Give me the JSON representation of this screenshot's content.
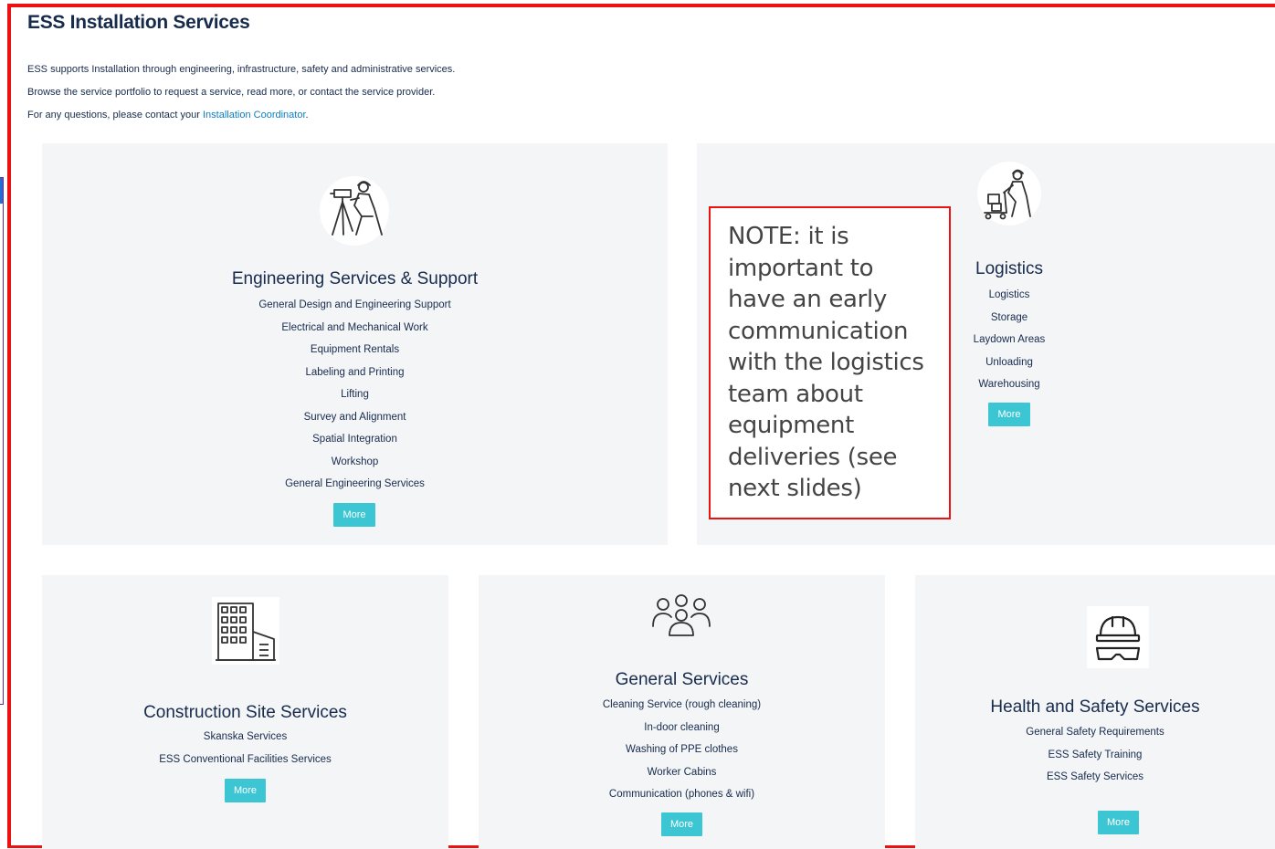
{
  "page": {
    "title": "ESS Installation Services",
    "intro_line1": "ESS supports Installation through engineering, infrastructure, safety and administrative services.",
    "intro_line2": "Browse the service portfolio to request a service, read more, or contact the service provider.",
    "intro_line3_prefix": "For any questions, please contact your ",
    "intro_link": "Installation Coordinator",
    "intro_line3_suffix": "."
  },
  "cards": {
    "engineering": {
      "title": "Engineering Services & Support",
      "icon": "surveyor-icon",
      "items": [
        "General Design and Engineering Support",
        "Electrical and Mechanical Work",
        "Equipment Rentals",
        "Labeling and Printing",
        "Lifting",
        "Survey and Alignment",
        "Spatial Integration",
        "Workshop",
        "General Engineering Services"
      ],
      "button": "More"
    },
    "logistics": {
      "title": "Logistics",
      "icon": "cart-worker-icon",
      "items": [
        "Logistics",
        "Storage",
        "Laydown Areas",
        "Unloading",
        "Warehousing"
      ],
      "button": "More"
    },
    "construction": {
      "title": "Construction Site Services",
      "icon": "building-icon",
      "items": [
        "Skanska Services",
        "ESS Conventional Facilities Services"
      ],
      "button": "More"
    },
    "general": {
      "title": "General Services",
      "icon": "people-group-icon",
      "items": [
        "Cleaning Service (rough cleaning)",
        "In-door cleaning",
        "Washing of PPE clothes",
        "Worker Cabins",
        "Communication (phones & wifi)"
      ],
      "button": "More"
    },
    "safety": {
      "title": "Health and Safety Services",
      "icon": "hardhat-goggles-icon",
      "items": [
        "General Safety Requirements",
        "ESS Safety Training",
        "ESS Safety Services"
      ],
      "button": "More"
    }
  },
  "note": {
    "text": "NOTE: it is important to have an early communication with the logistics team about equipment deliveries (see next slides)"
  },
  "colors": {
    "accent_button": "#3cc6d3",
    "link": "#0a7fc4",
    "card_bg": "#f4f5f7",
    "frame_border": "#ee1111",
    "heading": "#172b4d"
  }
}
